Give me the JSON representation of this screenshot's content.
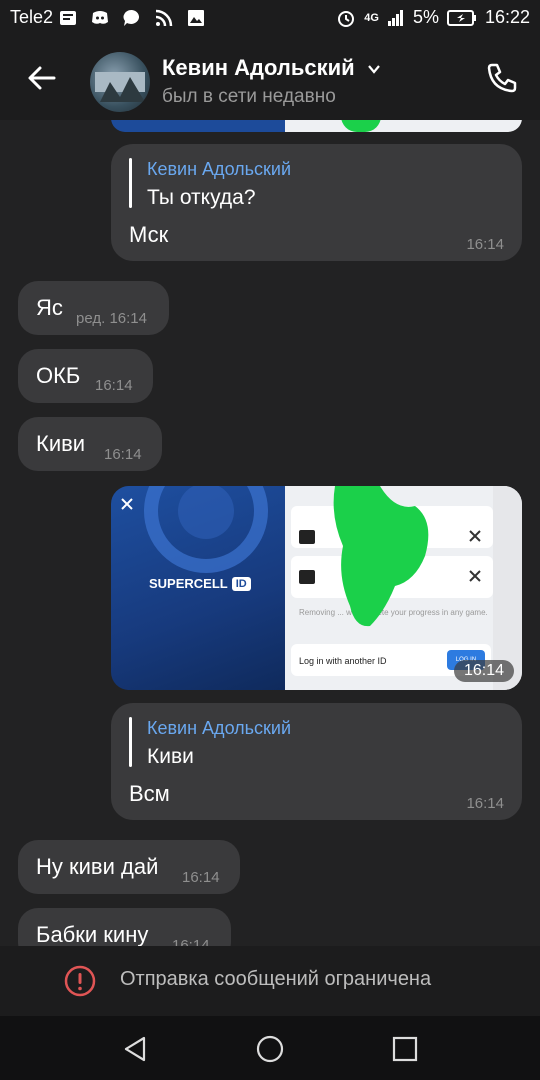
{
  "statusbar": {
    "carrier": "Tele2",
    "network": "4G",
    "battery": "5%",
    "time": "16:22"
  },
  "header": {
    "name": "Кевин Адольский",
    "status": "был в сети недавно"
  },
  "messages": [
    {
      "type": "reply",
      "reply_name": "Кевин Адольский",
      "reply_text": "Ты откуда?",
      "text": "Мск",
      "time": "16:14"
    },
    {
      "type": "in",
      "text": "Яс",
      "edited": "ред.",
      "time": "16:14"
    },
    {
      "type": "in",
      "text": "ОКБ",
      "time": "16:14"
    },
    {
      "type": "in",
      "text": "Киви",
      "time": "16:14"
    },
    {
      "type": "image",
      "time": "16:14",
      "image_texts": {
        "brand": "SUPERCELL",
        "badge": "ID",
        "login": "Log in with another ID",
        "removing": "Removing ... won't delete your progress in any game.",
        "btn": "LOG IN"
      }
    },
    {
      "type": "reply",
      "reply_name": "Кевин Адольский",
      "reply_text": "Киви",
      "text": "Всм",
      "time": "16:14"
    },
    {
      "type": "in",
      "text": "Ну киви дай",
      "time": "16:14"
    },
    {
      "type": "in",
      "text": "Бабки кину",
      "time": "16:14"
    }
  ],
  "banner": {
    "text": "Отправка сообщений ограничена"
  },
  "colors": {
    "accent_name": "#6aa8f0",
    "warning": "#e05555",
    "bubble": "#3a3a3c"
  }
}
